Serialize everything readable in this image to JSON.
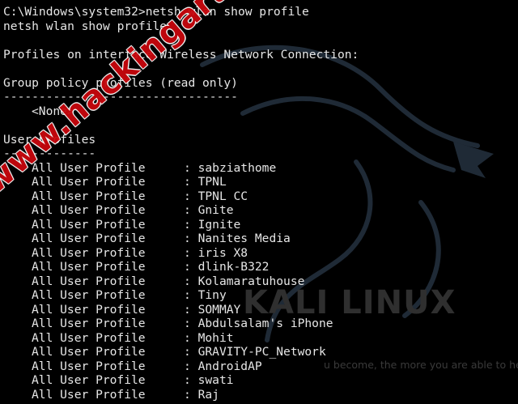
{
  "colors": {
    "background": "#000000",
    "text": "#e6e6e6",
    "watermark": "#c8070d",
    "logo_text": "#2f2f2f"
  },
  "terminal": {
    "prompt_line": "C:\\Windows\\system32>netsh wlan show profile",
    "echo_line": "netsh wlan show profile",
    "interface_line": "Profiles on interface Wireless Network Connection:",
    "group_policy_header": "Group policy profiles (read only)",
    "group_policy_rule": "---------------------------------",
    "group_policy_none": "<None>",
    "user_profiles_header": "User profiles",
    "user_profiles_rule": "-------------",
    "profile_label": "All User Profile",
    "separator": ":",
    "profiles": [
      "sabziathome",
      "TPNL",
      "TPNL CC",
      "Gnite",
      "Ignite",
      "Nanites Media",
      "iris X8",
      "dlink-B322",
      "Kolamaratuhouse",
      "Tiny",
      "SOMMAY",
      "Abdulsalam's iPhone",
      "Mohit",
      "GRAVITY-PC_Network",
      "AndroidAP",
      "swati",
      "Raj"
    ]
  },
  "background": {
    "logo_text": "KALI LINUX",
    "quote": "u become, the more you are able to hear."
  },
  "watermark": {
    "text": "www.hackingarticles.in"
  }
}
